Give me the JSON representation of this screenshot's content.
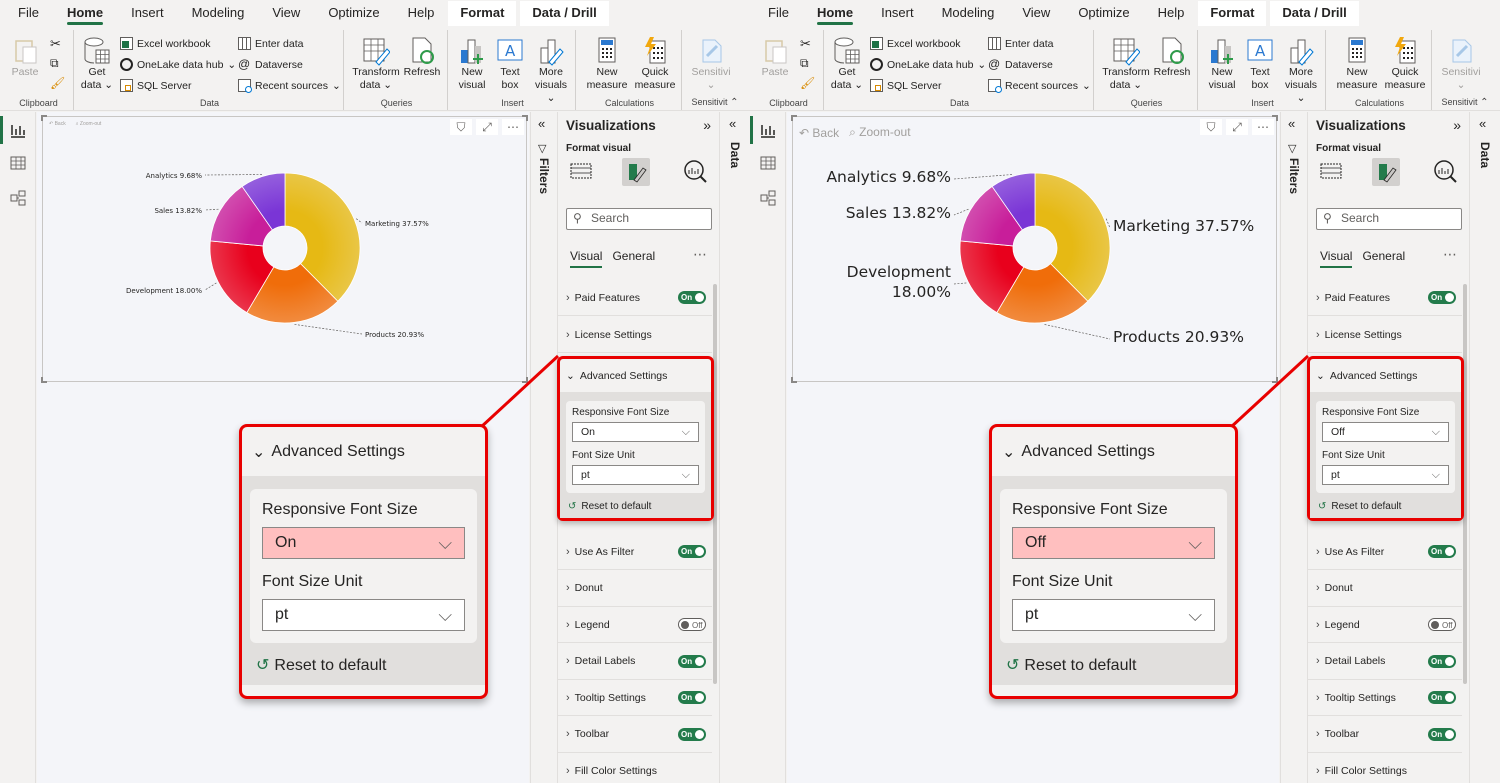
{
  "menu": [
    "File",
    "Home",
    "Insert",
    "Modeling",
    "View",
    "Optimize",
    "Help",
    "Format",
    "Data / Drill"
  ],
  "active_menu": "Home",
  "ribbon": {
    "clipboard": {
      "paste": "Paste",
      "group": "Clipboard"
    },
    "data": {
      "get_data": "Get",
      "get_data2": "data",
      "excel": "Excel workbook",
      "onelake": "OneLake data hub",
      "sql": "SQL Server",
      "enter": "Enter data",
      "dataverse": "Dataverse",
      "recent": "Recent sources",
      "group": "Data"
    },
    "queries": {
      "transform": "Transform",
      "transform2": "data",
      "refresh": "Refresh",
      "group": "Queries"
    },
    "insert": {
      "new_visual": "New",
      "new_visual2": "visual",
      "text_box": "Text",
      "text_box2": "box",
      "more_visuals": "More",
      "more_visuals2": "visuals",
      "group": "Insert"
    },
    "calculations": {
      "new_measure": "New",
      "new_measure2": "measure",
      "quick_measure": "Quick",
      "quick_measure2": "measure",
      "group": "Calculations"
    },
    "sensitivity": {
      "label": "Sensitivi",
      "group": "Sensitivit"
    }
  },
  "visual_toolbar": {
    "back": "Back",
    "zoom_out": "Zoom-out"
  },
  "panes": {
    "filters": "Filters",
    "data": "Data",
    "visualizations": "Visualizations",
    "format_visual": "Format visual",
    "search_placeholder": "Search",
    "tab_visual": "Visual",
    "tab_general": "General"
  },
  "sections_top": [
    {
      "label": "Paid Features",
      "toggle": "On"
    },
    {
      "label": "License Settings",
      "toggle": null
    }
  ],
  "advanced": {
    "title": "Advanced Settings",
    "responsive_label": "Responsive Font Size",
    "unit_label": "Font Size Unit",
    "unit_value": "pt",
    "reset": "Reset to default"
  },
  "sections_bottom": [
    {
      "label": "Use As Filter",
      "toggle": "On"
    },
    {
      "label": "Donut",
      "toggle": null
    },
    {
      "label": "Legend",
      "toggle": "Off"
    },
    {
      "label": "Detail Labels",
      "toggle": "On"
    },
    {
      "label": "Tooltip Settings",
      "toggle": "On"
    },
    {
      "label": "Toolbar",
      "toggle": "On"
    },
    {
      "label": "Fill Color Settings",
      "toggle": null
    }
  ],
  "left": {
    "responsive_value": "On"
  },
  "right": {
    "responsive_value": "Off"
  },
  "chart_data": {
    "type": "pie",
    "variant": "donut",
    "categories": [
      "Marketing",
      "Products",
      "Development",
      "Sales",
      "Analytics"
    ],
    "values": [
      37.57,
      20.93,
      18.0,
      13.82,
      9.68
    ],
    "labels": [
      "Marketing 37.57%",
      "Products 20.93%",
      "Development 18.00%",
      "Sales 13.82%",
      "Analytics 9.68%"
    ],
    "colors": [
      "#e6b914",
      "#f06d0a",
      "#e8001c",
      "#c81e9a",
      "#7a35d6"
    ],
    "legend": "off"
  }
}
